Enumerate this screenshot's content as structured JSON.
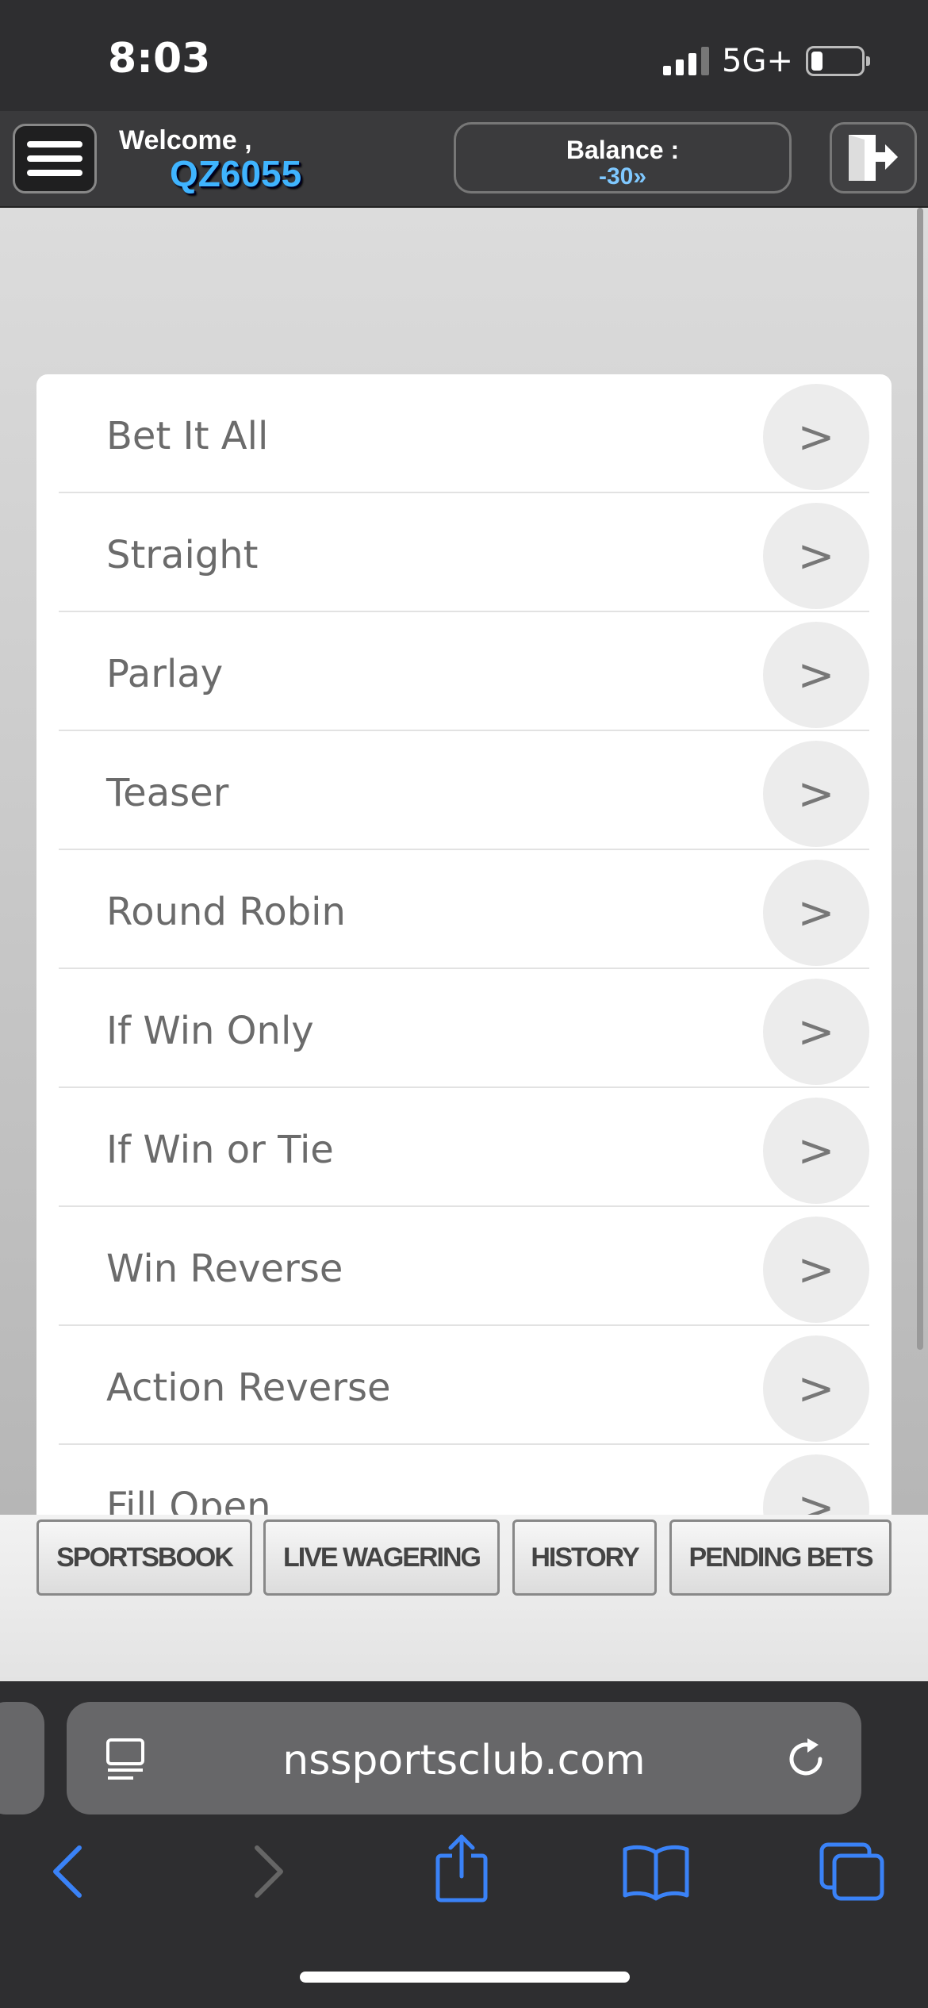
{
  "status_bar": {
    "time": "8:03",
    "network": "5G+"
  },
  "header": {
    "welcome": "Welcome ,",
    "user_id": "QZ6055",
    "balance_label": "Balance :",
    "balance_value": "-30»"
  },
  "menu": {
    "items": [
      {
        "label": "Bet It All"
      },
      {
        "label": "Straight"
      },
      {
        "label": "Parlay"
      },
      {
        "label": "Teaser"
      },
      {
        "label": "Round Robin"
      },
      {
        "label": "If Win Only"
      },
      {
        "label": "If Win or Tie"
      },
      {
        "label": "Win Reverse"
      },
      {
        "label": "Action Reverse"
      },
      {
        "label": "Fill Open"
      }
    ],
    "arrow": ">"
  },
  "bottom_nav": {
    "sportsbook": "SPORTSBOOK",
    "live_wagering": "LIVE WAGERING",
    "history": "HISTORY",
    "pending_bets": "PENDING BETS"
  },
  "browser": {
    "url": "nssportsclub.com"
  },
  "colors": {
    "accent_user": "#3fb4ff",
    "ios_blue": "#3a82f7"
  }
}
